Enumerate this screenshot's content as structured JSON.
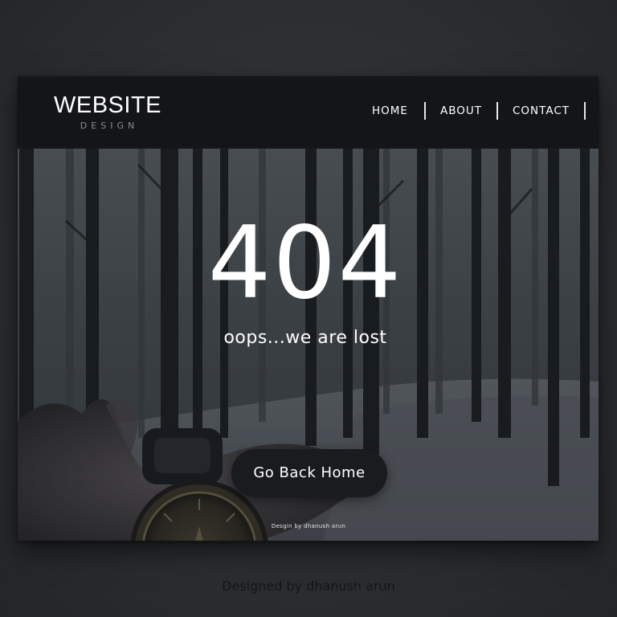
{
  "brand": {
    "title": "WEBSITE",
    "subtitle": "DESIGN"
  },
  "nav": {
    "items": [
      {
        "label": "HOME"
      },
      {
        "label": "ABOUT"
      },
      {
        "label": "CONTACT"
      }
    ]
  },
  "hero": {
    "error_code": "404",
    "message": "oops...we are lost",
    "button_label": "Go Back Home",
    "inner_credit": "Desgin by dhanush arun"
  },
  "footer": {
    "credit": "Designed by dhanush arun"
  },
  "colors": {
    "navbar": "#131519",
    "button": "#1a1b1f",
    "text": "#ffffff",
    "page_bg": "#2f3235"
  },
  "icons": {
    "background_image": "compass-in-forest-photo"
  }
}
